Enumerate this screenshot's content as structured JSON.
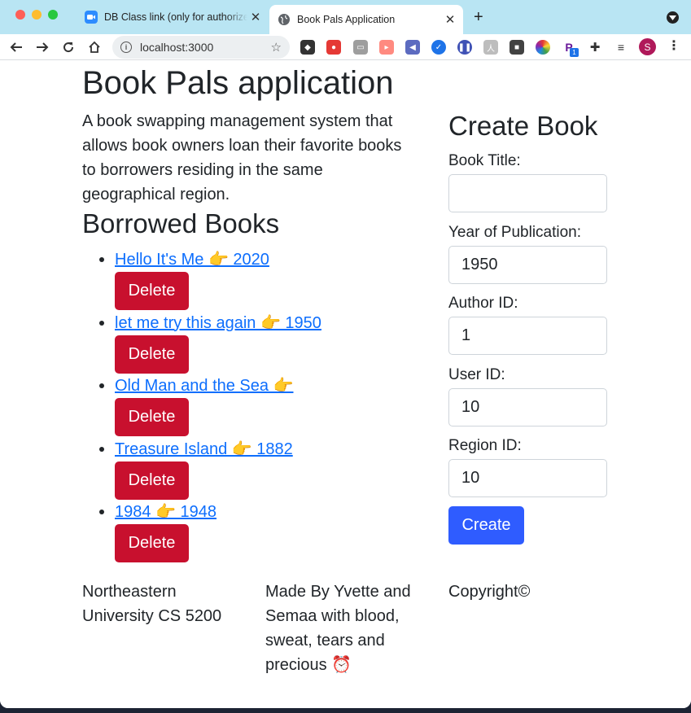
{
  "browser": {
    "tabs": [
      {
        "title": "DB Class link (only for authorized",
        "active": false
      },
      {
        "title": "Book Pals Application",
        "active": true
      }
    ],
    "url": "localhost:3000",
    "profile_initial": "S",
    "extension_badge": "1"
  },
  "page": {
    "title": "Book Pals application",
    "description": "A book swapping management system that allows book owners loan their favorite books to borrowers residing in the same geographical region.",
    "borrowed_title": "Borrowed Books",
    "books": [
      {
        "label": "Hello It's Me 👉 2020",
        "delete_label": "Delete"
      },
      {
        "label": "let me try this again 👉 1950",
        "delete_label": "Delete"
      },
      {
        "label": "Old Man and the Sea 👉",
        "delete_label": "Delete"
      },
      {
        "label": "Treasure Island 👉 1882",
        "delete_label": "Delete"
      },
      {
        "label": "1984 👉 1948",
        "delete_label": "Delete"
      }
    ],
    "form": {
      "title": "Create Book",
      "book_title_label": "Book Title:",
      "book_title_value": "",
      "year_label": "Year of Publication:",
      "year_value": "1950",
      "author_label": "Author ID:",
      "author_value": "1",
      "user_label": "User ID:",
      "user_value": "10",
      "region_label": "Region ID:",
      "region_value": "10",
      "submit_label": "Create"
    },
    "footer": {
      "col1": "Northeastern University CS 5200",
      "col2": "Made By Yvette and Semaa with blood, sweat, tears and precious ⏰",
      "col3": "Copyright©"
    }
  },
  "colors": {
    "tabstrip": "#b9e5f3",
    "link": "#0d6efd",
    "delete": "#c8102e",
    "create": "#2f5cff"
  }
}
